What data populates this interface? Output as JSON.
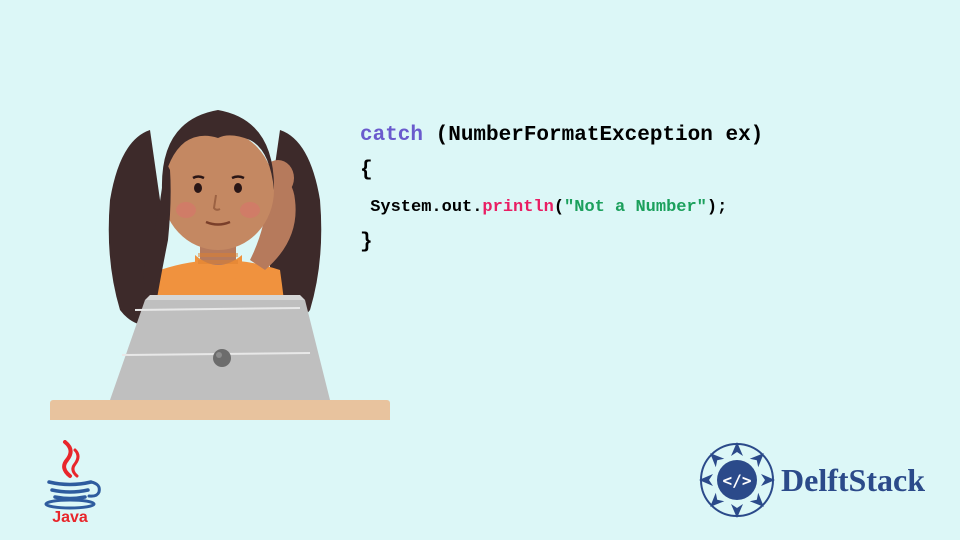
{
  "code": {
    "line1_catch": "catch",
    "line1_rest": " (NumberFormatException ex)",
    "line2": "{",
    "line3_pre": " System.out.",
    "line3_println": "println",
    "line3_paren_open": "(",
    "line3_string": "\"Not a Number\"",
    "line3_paren_close": ");",
    "line4": "}"
  },
  "java_logo_text": "Java",
  "delft_logo_text": "DelftStack"
}
